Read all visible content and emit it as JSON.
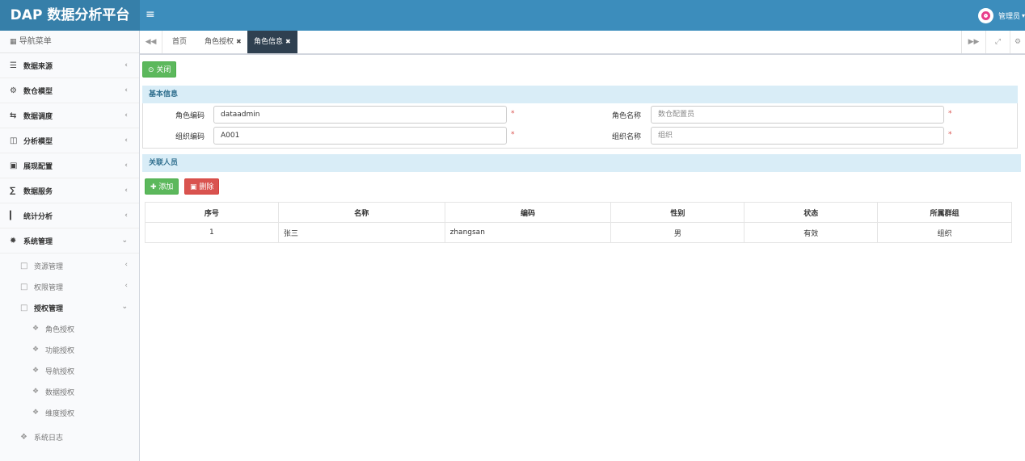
{
  "header": {
    "logo": "DAP 数据分析平台",
    "menu_icon": "hamburger-icon",
    "user": "管理员"
  },
  "sidebar": {
    "title": "导航菜单",
    "items": [
      {
        "label": "数据来源",
        "icon": "database-icon"
      },
      {
        "label": "数仓模型",
        "icon": "sitemap-icon"
      },
      {
        "label": "数据调度",
        "icon": "random-icon"
      },
      {
        "label": "分析模型",
        "icon": "chart-icon"
      },
      {
        "label": "展现配置",
        "icon": "film-icon"
      },
      {
        "label": "数据服务",
        "icon": "service-icon"
      },
      {
        "label": "统计分析",
        "icon": "bar-chart-icon"
      },
      {
        "label": "系统管理",
        "icon": "gear-icon"
      }
    ],
    "sub_items": [
      {
        "label": "资源管理"
      },
      {
        "label": "权限管理"
      },
      {
        "label": "授权管理"
      }
    ],
    "sub_sub_items": [
      {
        "label": "角色授权"
      },
      {
        "label": "功能授权"
      },
      {
        "label": "导航授权"
      },
      {
        "label": "数据授权"
      },
      {
        "label": "维度授权"
      }
    ],
    "log": "系统日志"
  },
  "tabs": [
    {
      "label": "首页"
    },
    {
      "label": "角色授权"
    },
    {
      "label": "角色信息"
    }
  ],
  "toolbar": {
    "close_label": "关闭"
  },
  "basic_info": {
    "title": "基本信息",
    "role_code_label": "角色编码",
    "role_code_value": "dataadmin",
    "role_name_label": "角色名称",
    "role_name_value": "数仓配置员",
    "org_code_label": "组织编码",
    "org_code_value": "A001",
    "org_name_label": "组织名称",
    "org_name_value": "组织",
    "required": "*"
  },
  "related": {
    "title": "关联人员",
    "add_label": "添加",
    "delete_label": "删除",
    "columns": [
      "序号",
      "名称",
      "编码",
      "性别",
      "状态",
      "所属群组"
    ],
    "rows": [
      [
        "1",
        "张三",
        "zhangsan",
        "男",
        "有效",
        "组织"
      ]
    ]
  }
}
